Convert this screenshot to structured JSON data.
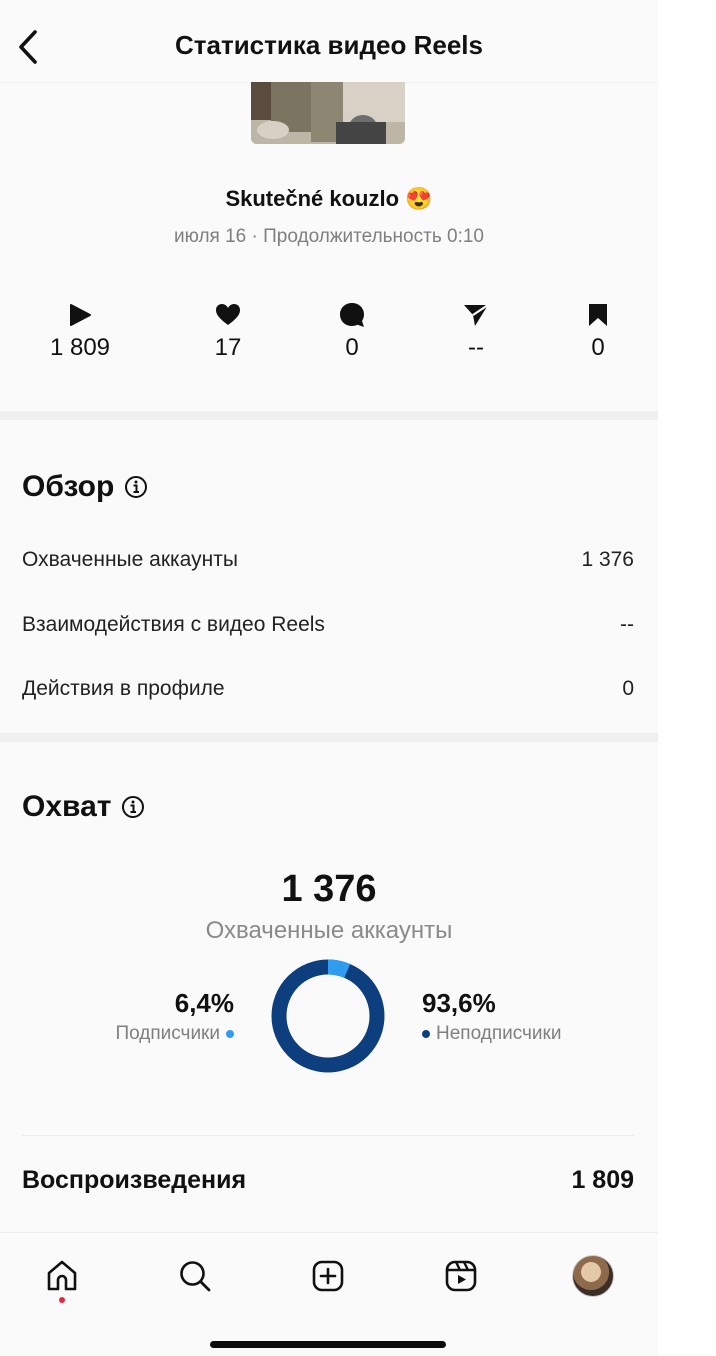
{
  "header": {
    "title": "Статистика видео Reels"
  },
  "reel": {
    "title": "Skutečné kouzlo 😍",
    "meta": "июля 16 · Продолжительность 0:10"
  },
  "stats": [
    {
      "icon": "play-icon",
      "value": "1 809"
    },
    {
      "icon": "heart-icon",
      "value": "17"
    },
    {
      "icon": "comment-icon",
      "value": "0"
    },
    {
      "icon": "share-icon",
      "value": "--"
    },
    {
      "icon": "bookmark-icon",
      "value": "0"
    }
  ],
  "overview": {
    "title": "Обзор",
    "rows": [
      {
        "label": "Охваченные аккаунты",
        "value": "1 376"
      },
      {
        "label": "Взаимодействия с видео Reels",
        "value": "--"
      },
      {
        "label": "Действия в профиле",
        "value": "0"
      }
    ]
  },
  "reach": {
    "title": "Охват",
    "total": "1 376",
    "total_label": "Охваченные аккаунты",
    "followers_pct": "6,4%",
    "followers_label": "Подписчики",
    "nonfollowers_pct": "93,6%",
    "nonfollowers_label": "Неподписчики",
    "followers_fraction": 0.064,
    "colors": {
      "followers": "#2f9cf0",
      "nonfollowers": "#0d3e7e"
    }
  },
  "plays": {
    "label": "Воспроизведения",
    "value": "1 809"
  },
  "tabbar": [
    "home-icon",
    "search-icon",
    "create-icon",
    "reels-icon",
    "profile-avatar"
  ]
}
